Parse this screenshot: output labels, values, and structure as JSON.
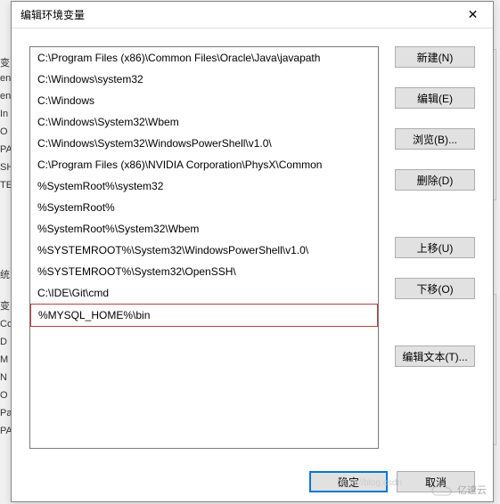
{
  "bg": {
    "labels": [
      "变",
      "en",
      "en",
      "In",
      "O",
      "PA",
      "SH",
      "TE",
      "统",
      "变",
      "Co",
      "D",
      "M",
      "N",
      "O",
      "Pa",
      "PA"
    ]
  },
  "dialog": {
    "title": "编辑环境变量",
    "close": "✕",
    "list": [
      "C:\\Program Files (x86)\\Common Files\\Oracle\\Java\\javapath",
      "C:\\Windows\\system32",
      "C:\\Windows",
      "C:\\Windows\\System32\\Wbem",
      "C:\\Windows\\System32\\WindowsPowerShell\\v1.0\\",
      "C:\\Program Files (x86)\\NVIDIA Corporation\\PhysX\\Common",
      "%SystemRoot%\\system32",
      "%SystemRoot%",
      "%SystemRoot%\\System32\\Wbem",
      "%SYSTEMROOT%\\System32\\WindowsPowerShell\\v1.0\\",
      "%SYSTEMROOT%\\System32\\OpenSSH\\",
      "C:\\IDE\\Git\\cmd",
      "%MYSQL_HOME%\\bin"
    ],
    "highlighted_index": 12,
    "buttons": {
      "new": "新建(N)",
      "edit": "编辑(E)",
      "browse": "浏览(B)...",
      "delete": "删除(D)",
      "up": "上移(U)",
      "down": "下移(O)",
      "edit_text": "编辑文本(T)...",
      "ok": "确定",
      "cancel": "取消"
    }
  },
  "watermark": {
    "text": "亿速云",
    "overlay": "https://blog.csdn"
  }
}
